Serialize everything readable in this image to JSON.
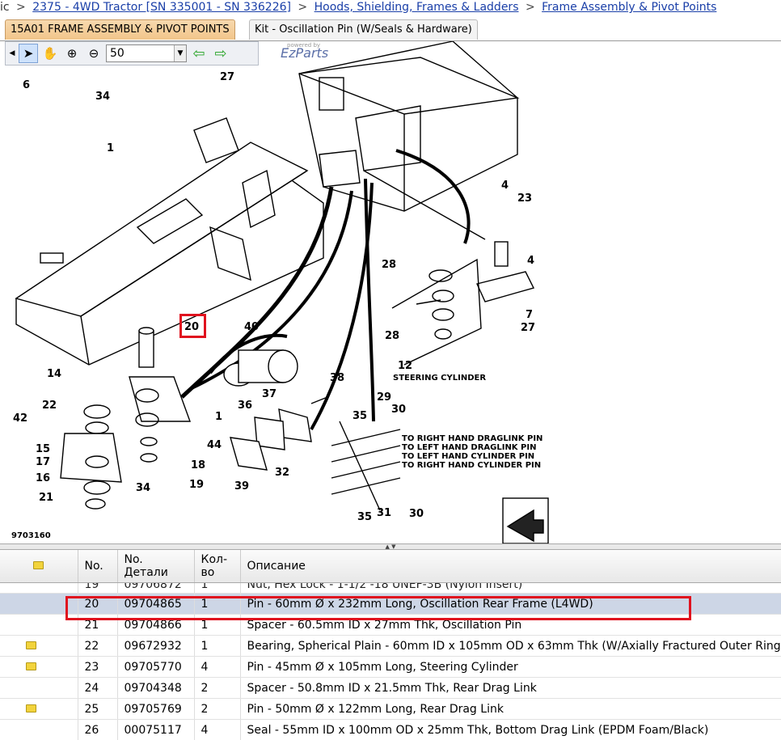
{
  "breadcrumb": {
    "prefix": "ic",
    "items": [
      "2375 - 4WD Tractor [SN 335001 - SN 336226]",
      "Hoods, Shielding, Frames & Ladders",
      "Frame Assembly & Pivot Points"
    ],
    "separator": ">"
  },
  "tabs": [
    {
      "label": "15A01 FRAME ASSEMBLY & PIVOT POINTS",
      "active": true
    },
    {
      "label": "Kit - Oscillation Pin (W/Seals & Hardware)",
      "active": false
    }
  ],
  "toolbar": {
    "zoom_value": "50",
    "icons": [
      "select-arrow-icon",
      "pan-hand-icon",
      "zoom-in-icon",
      "zoom-out-icon",
      "back-arrow-icon",
      "forward-arrow-icon"
    ],
    "brand_small": "powered by",
    "brand": "EzParts"
  },
  "diagram": {
    "callouts": [
      "6",
      "34",
      "27",
      "1",
      "4",
      "23",
      "28",
      "4",
      "7",
      "27",
      "28",
      "12",
      "20",
      "40",
      "14",
      "22",
      "42",
      "15",
      "17",
      "16",
      "21",
      "34",
      "18",
      "19",
      "44",
      "37",
      "38",
      "36",
      "1",
      "39",
      "35",
      "29",
      "30",
      "32",
      "35",
      "31",
      "30"
    ],
    "annotations": [
      "STEERING CYLINDER",
      "TO RIGHT HAND DRAGLINK PIN",
      "TO LEFT HAND DRAGLINK PIN",
      "TO LEFT HAND CYLINDER PIN",
      "TO RIGHT HAND CYLINDER PIN"
    ],
    "figure_id": "9703160",
    "highlighted_callout": "20"
  },
  "grid": {
    "headers": [
      "",
      "No.",
      "No. Детали",
      "Кол-во",
      "Описание"
    ],
    "partial_row": {
      "no": "19",
      "part": "09706872",
      "qty": "1",
      "desc": "Nut, Hex Lock - 1-1/2 -18 UNEF-3B (Nylon Insert)"
    },
    "rows": [
      {
        "icon": false,
        "no": "20",
        "part": "09704865",
        "qty": "1",
        "desc": "Pin - 60mm Ø x 232mm Long, Oscillation Rear Frame (L4WD)",
        "selected": true
      },
      {
        "icon": false,
        "no": "21",
        "part": "09704866",
        "qty": "1",
        "desc": "Spacer - 60.5mm ID x 27mm Thk, Oscillation Pin",
        "selected": false
      },
      {
        "icon": true,
        "no": "22",
        "part": "09672932",
        "qty": "1",
        "desc": "Bearing, Spherical Plain - 60mm ID x 105mm OD x 63mm Thk (W/Axially Fractured Outer Ring",
        "selected": false
      },
      {
        "icon": true,
        "no": "23",
        "part": "09705770",
        "qty": "4",
        "desc": "Pin - 45mm Ø x 105mm Long, Steering Cylinder",
        "selected": false
      },
      {
        "icon": false,
        "no": "24",
        "part": "09704348",
        "qty": "2",
        "desc": "Spacer - 50.8mm ID x 21.5mm Thk, Rear Drag Link",
        "selected": false
      },
      {
        "icon": true,
        "no": "25",
        "part": "09705769",
        "qty": "2",
        "desc": "Pin - 50mm Ø x 122mm Long, Rear Drag Link",
        "selected": false
      },
      {
        "icon": false,
        "no": "26",
        "part": "00075117",
        "qty": "4",
        "desc": "Seal - 55mm ID x 100mm OD x 25mm Thk, Bottom Drag Link (EPDM Foam/Black)",
        "selected": false
      }
    ]
  },
  "colors": {
    "highlight": "#e0121e",
    "selected_row": "#cdd6e6",
    "tab_active": "#f2c58a",
    "link": "#1a3fa8"
  }
}
